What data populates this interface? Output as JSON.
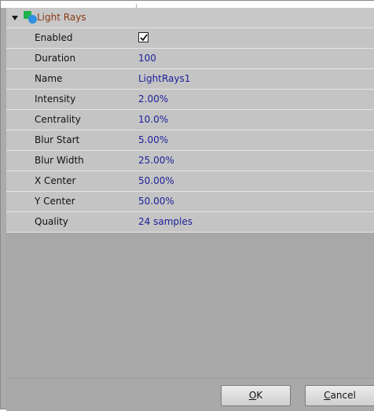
{
  "effect": {
    "title": "Light Rays",
    "icon": "light-rays-effect-icon",
    "expanded": true
  },
  "properties": [
    {
      "key": "enabled",
      "label": "Enabled",
      "value": "",
      "type": "checkbox",
      "checked": true
    },
    {
      "key": "duration",
      "label": "Duration",
      "value": "100"
    },
    {
      "key": "name",
      "label": "Name",
      "value": "LightRays1"
    },
    {
      "key": "intensity",
      "label": "Intensity",
      "value": "2.00%"
    },
    {
      "key": "centrality",
      "label": "Centrality",
      "value": "10.0%"
    },
    {
      "key": "blur_start",
      "label": "Blur Start",
      "value": "5.00%"
    },
    {
      "key": "blur_width",
      "label": "Blur Width",
      "value": "25.00%"
    },
    {
      "key": "x_center",
      "label": "X Center",
      "value": "50.00%"
    },
    {
      "key": "y_center",
      "label": "Y Center",
      "value": "50.00%"
    },
    {
      "key": "quality",
      "label": "Quality",
      "value": "24 samples"
    }
  ],
  "buttons": {
    "ok": {
      "mnemonic": "O",
      "rest": "K"
    },
    "cancel": {
      "mnemonic": "C",
      "rest": "ancel"
    }
  },
  "colors": {
    "label_text": "#111111",
    "value_text": "#1b1f9a",
    "header_title": "#8b3a12",
    "row_bg": "#c4c4c4",
    "panel_bg": "#a8a8a8"
  }
}
